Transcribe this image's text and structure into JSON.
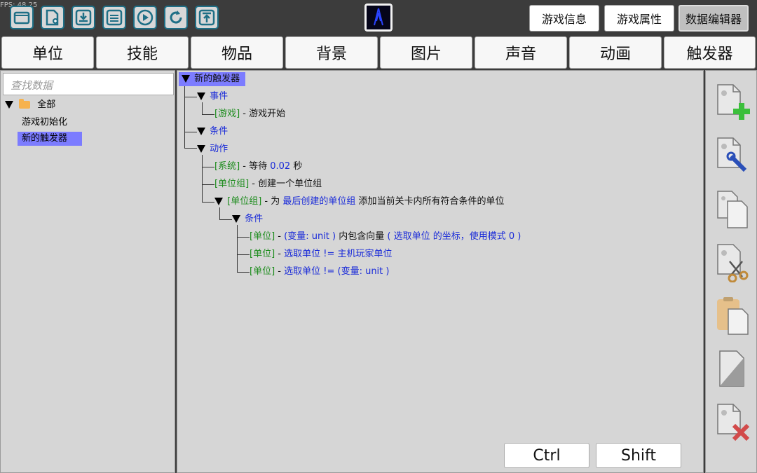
{
  "fps_label": "FPS: 48.25",
  "toolbar": {
    "icons": [
      "open-folder-icon",
      "new-file-icon",
      "download-icon",
      "save-icon",
      "play-icon",
      "refresh-icon",
      "upload-icon"
    ],
    "game_info": "游戏信息",
    "game_props": "游戏属性",
    "data_editor": "数据编辑器"
  },
  "tabs": [
    "单位",
    "技能",
    "物品",
    "背景",
    "图片",
    "声音",
    "动画",
    "触发器"
  ],
  "left": {
    "search_placeholder": "查找数据",
    "root": "全部",
    "items": [
      "游戏初始化",
      "新的触发器"
    ]
  },
  "tree": {
    "root": "新的触发器",
    "events": "事件",
    "ev1_tag": "[游戏]",
    "ev1_sep": " - ",
    "ev1_text": "游戏开始",
    "conditions": "条件",
    "actions": "动作",
    "a1_tag": "[系统]",
    "a1_sep": " - 等待 ",
    "a1_val": "0.02",
    "a1_unit": " 秒",
    "a2_tag": "[单位组]",
    "a2_text": " - 创建一个单位组",
    "a3_tag": "[单位组]",
    "a3_pre": " - 为 ",
    "a3_target": "最后创建的单位组",
    "a3_text": " 添加当前关卡内所有符合条件的单位",
    "a3_cond": "条件",
    "c1_tag": "[单位]",
    "c1_sep": " - ",
    "c1_a": "(变量: unit )",
    "c1_b": " 内包含向量 ",
    "c1_c": "( 选取单位 的坐标，使用模式 0 )",
    "c2_tag": "[单位]",
    "c2_sep": " - ",
    "c2_a": "选取单位  !=  主机玩家单位",
    "c3_tag": "[单位]",
    "c3_sep": " - ",
    "c3_a": "选取单位  !=  (变量: unit )"
  },
  "keys": {
    "ctrl": "Ctrl",
    "shift": "Shift"
  },
  "right_icons": [
    "add-doc-icon",
    "edit-doc-icon",
    "copy-doc-icon",
    "cut-doc-icon",
    "paste-doc-icon",
    "blank-doc-icon",
    "delete-doc-icon"
  ]
}
